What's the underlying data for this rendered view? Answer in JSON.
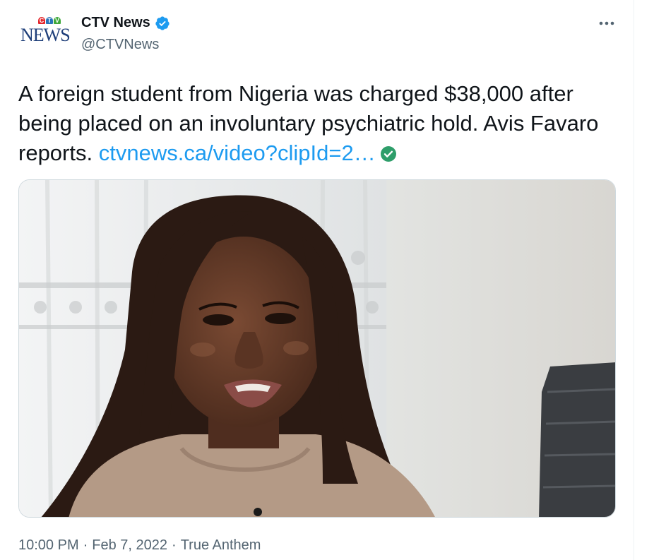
{
  "author": {
    "avatar_logo_mark": [
      "C",
      "T",
      "V"
    ],
    "avatar_logo_word": "NEWS",
    "display_name": "CTV News",
    "handle": "@CTVNews",
    "verified_icon": "verified-badge-icon"
  },
  "tweet": {
    "text": "A foreign student from Nigeria was charged $38,000 after being placed on an involuntary psychiatric hold. Avis Favaro reports.",
    "link_text": "ctvnews.ca/video?clipId=2…",
    "link_badge_icon": "check-circle-icon"
  },
  "media": {
    "type": "video-still"
  },
  "meta": {
    "time": "10:00 PM",
    "separator": "·",
    "date": "Feb 7, 2022",
    "source": "True Anthem"
  },
  "colors": {
    "link": "#1d9bf0",
    "verified": "#1d9bf0",
    "secondary_text": "#536471",
    "primary_text": "#0f1419",
    "link_badge": "#2e9e6a"
  }
}
